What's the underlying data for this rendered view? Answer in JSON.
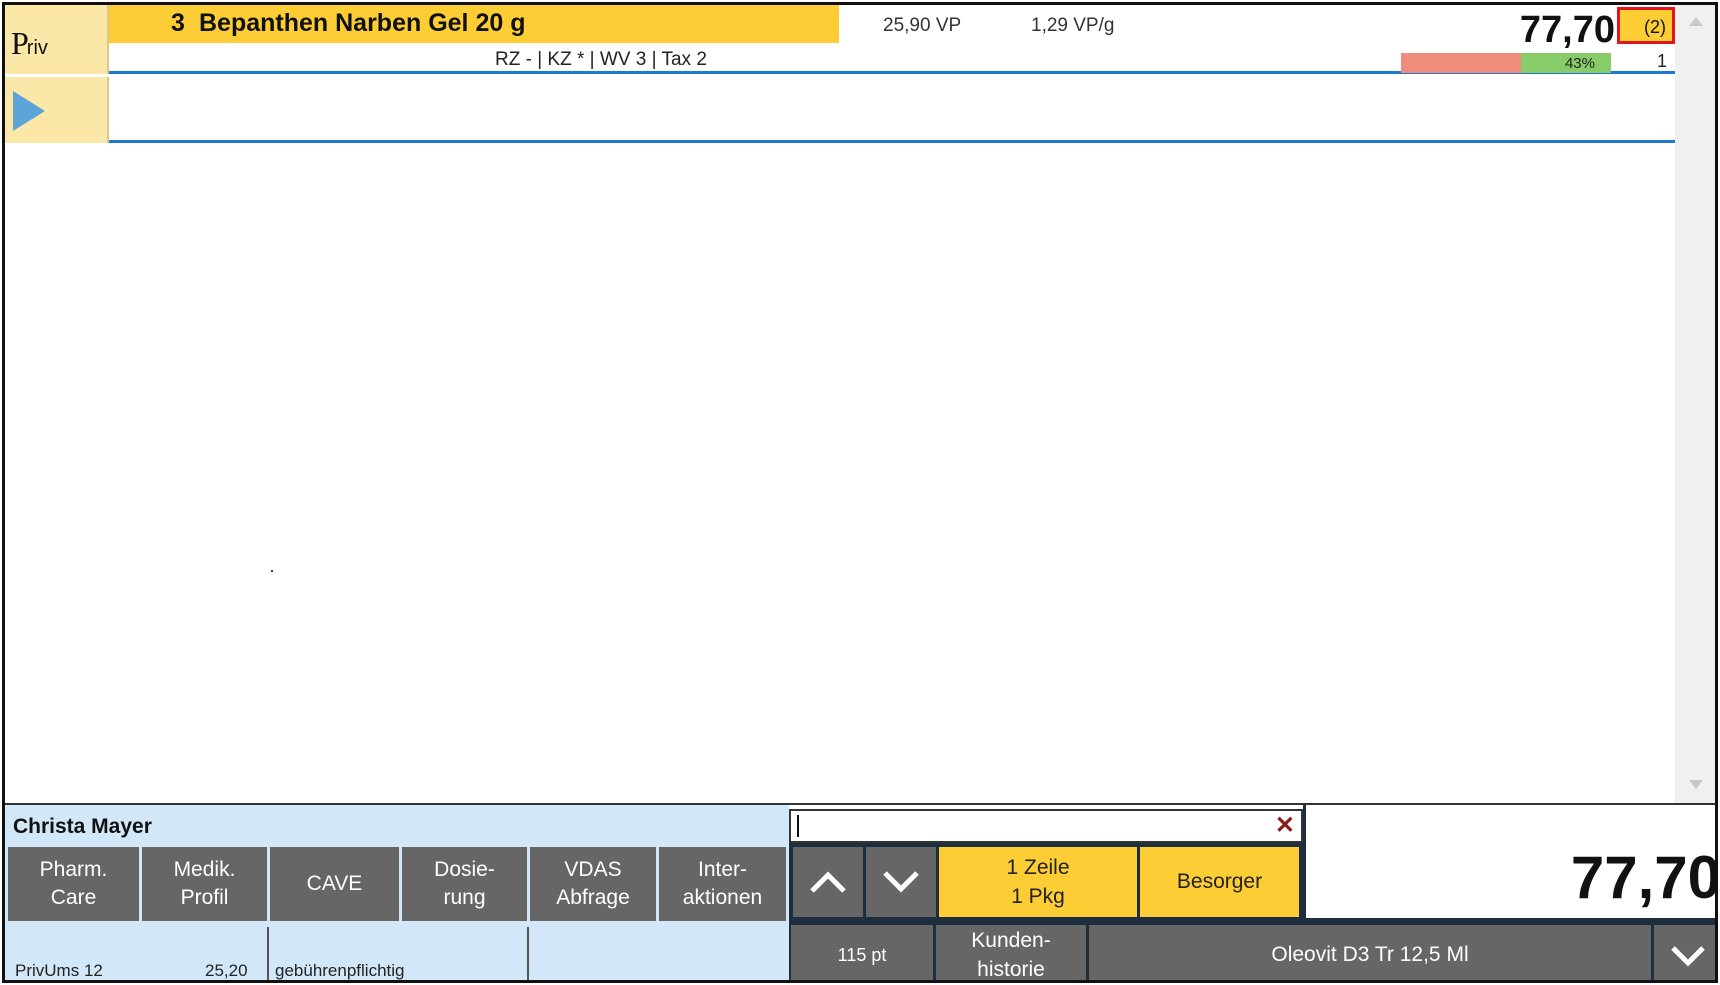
{
  "row1": {
    "priv_p": "P",
    "priv_rest": "riv",
    "quantity": "3",
    "product_name": "Bepanthen Narben Gel 20 g",
    "vp": "25,90 VP",
    "vp_per_g": "1,29 VP/g",
    "price": "77,70",
    "count": "(2)",
    "subinfo": "RZ - | KZ *  | WV 3 | Tax 2",
    "margin_percent": "43%",
    "margin_value": 0.43,
    "row_qty": "1"
  },
  "customer": {
    "name": "Christa Mayer",
    "buttons": [
      {
        "label": "Pharm.\nCare"
      },
      {
        "label": "Medik.\nProfil"
      },
      {
        "label": "CAVE"
      },
      {
        "label": "Dosie-\nrung"
      },
      {
        "label": "VDAS\nAbfrage"
      },
      {
        "label": "Inter-\naktionen"
      }
    ],
    "privums_label": "PrivUms 12",
    "privums_value": "25,20",
    "fee_status": "gebührenpflichtig"
  },
  "actions": {
    "zeile": "1 Zeile\n1 Pkg",
    "besorger": "Besorger",
    "points": "115 pt",
    "kundenhistorie": "Kunden-\nhistorie",
    "product_suggestion": "Oleovit D3 Tr 12,5 Ml"
  },
  "total": "77,70",
  "colors": {
    "accent_yellow": "#fccd34",
    "row_blue": "#1e78d2",
    "button_gray": "#666666",
    "panel_blue": "#d2e8f8",
    "highlight_red": "#e2141c"
  }
}
